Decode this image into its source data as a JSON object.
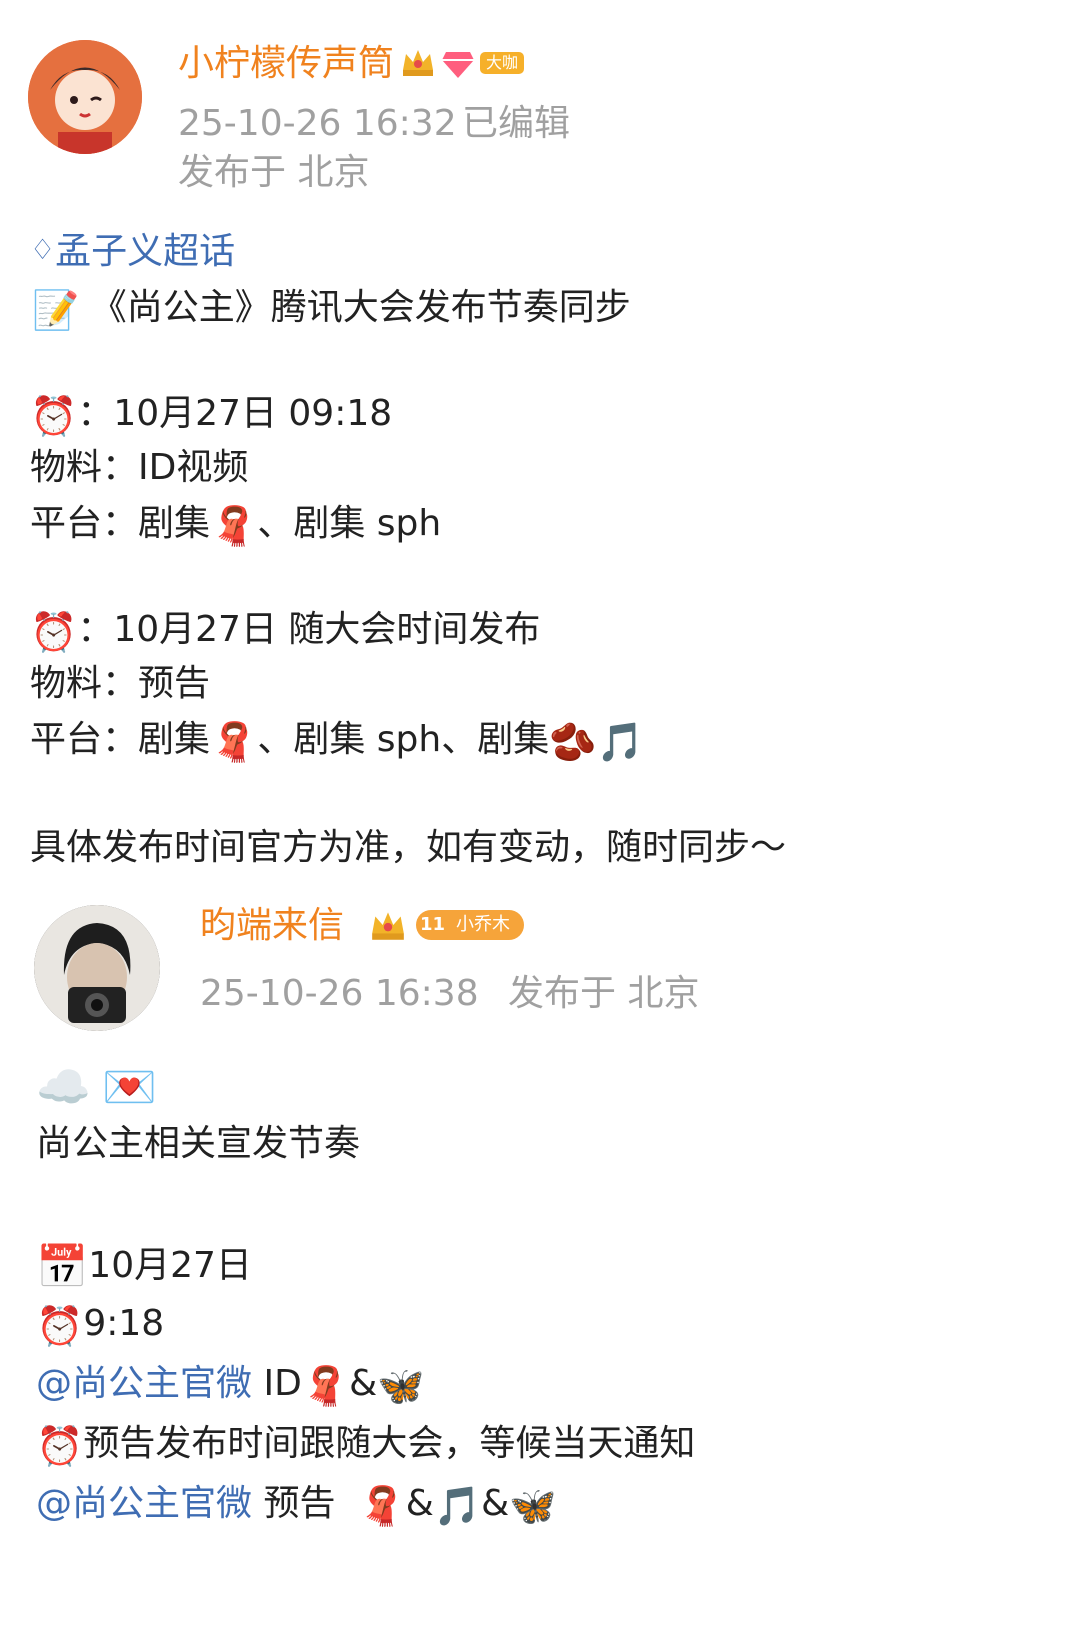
{
  "post1": {
    "author": "小柠檬传声筒",
    "badge_text": "大咖",
    "timestamp": "25-10-26 16:32",
    "edited": "已编辑",
    "location": "发布于 北京",
    "topic": "孟子义超话",
    "title": "《尚公主》腾讯大会发布节奏同步",
    "block1_time": "：10月27日 09:18",
    "block1_material": "物料：ID视频",
    "block1_platform_a": "平台：剧集",
    "block1_platform_b": "、剧集 sph",
    "block2_time": "：10月27日 随大会时间发布",
    "block2_material": "物料：预告",
    "block2_platform_a": "平台：剧集",
    "block2_platform_b": "、剧集 sph、剧集",
    "footer": "具体发布时间官方为准，如有变动，随时同步～"
  },
  "post2": {
    "author": "昀端来信",
    "level_badge": "11",
    "badge_text": "小乔木",
    "timestamp": "25-10-26 16:38",
    "location": "发布于 北京",
    "title": "尚公主相关宣发节奏",
    "date": "10月27日",
    "time": "9:18",
    "mention1": "@尚公主官微",
    "mention1_rest": " ID",
    "amp": "&",
    "notice": "预告发布时间跟随大会，等候当天通知",
    "mention2": "@尚公主官微",
    "mention2_rest": " 预告",
    "calendar_month": "JUL",
    "calendar_day": "17"
  },
  "icons": [
    "memo-icon",
    "alarm-clock-icon",
    "scarf-icon",
    "beans-icon",
    "music-note-icon",
    "cloud-icon",
    "love-letter-icon",
    "calendar-icon",
    "butterfly-icon",
    "crown-icon",
    "diamond-icon"
  ]
}
